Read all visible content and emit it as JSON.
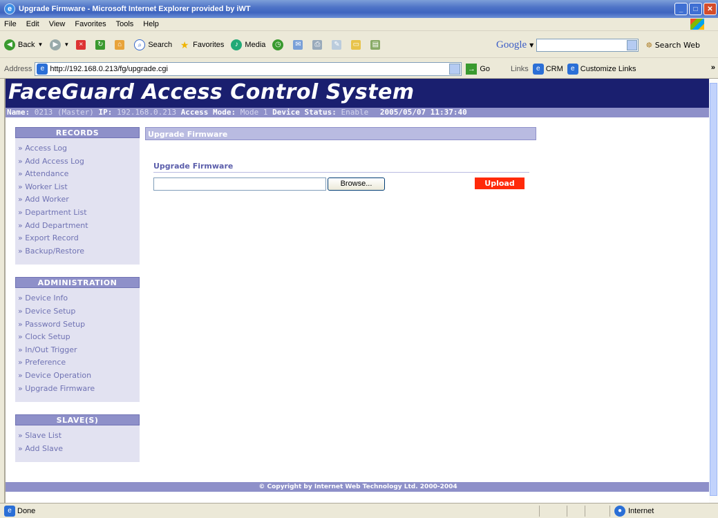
{
  "window": {
    "title": "Upgrade Firmware - Microsoft Internet Explorer provided by iWT"
  },
  "menu": [
    "File",
    "Edit",
    "View",
    "Favorites",
    "Tools",
    "Help"
  ],
  "toolbar": {
    "back": "Back",
    "search": "Search",
    "favorites": "Favorites",
    "media": "Media"
  },
  "google": {
    "logo": "Google",
    "search_web": "Search Web"
  },
  "address": {
    "label": "Address",
    "url": "http://192.168.0.213/fg/upgrade.cgi",
    "go": "Go",
    "links_label": "Links",
    "link1": "CRM",
    "link2": "Customize Links"
  },
  "page": {
    "banner": "FaceGuard Access Control System",
    "status": {
      "name_label": "Name:",
      "name_value": "0213 (Master)",
      "ip_label": "IP:",
      "ip_value": "192.168.0.213",
      "mode_label": "Access Mode:",
      "mode_value": "Mode 1",
      "device_label": "Device Status:",
      "device_value": "Enable",
      "datetime": "2005/05/07 11:37:40"
    },
    "sections": [
      {
        "title": "RECORDS",
        "items": [
          "» Access Log",
          "» Add Access Log",
          "» Attendance",
          "» Worker List",
          "» Add Worker",
          "» Department List",
          "» Add Department",
          "» Export Record",
          "» Backup/Restore"
        ]
      },
      {
        "title": "ADMINISTRATION",
        "items": [
          "» Device Info",
          "» Device Setup",
          "» Password Setup",
          "» Clock Setup",
          "» In/Out Trigger",
          "» Preference",
          "» Device Operation",
          "» Upgrade Firmware"
        ]
      },
      {
        "title": "SLAVE(S)",
        "items": [
          "» Slave List",
          "» Add Slave"
        ]
      }
    ],
    "page_title": "Upgrade Firmware",
    "form_title": "Upgrade Firmware",
    "browse_label": "Browse...",
    "upload_label": "Upload",
    "footer": "© Copyright by Internet Web Technology Ltd. 2000-2004"
  },
  "statusbar": {
    "text": "Done",
    "zone": "Internet"
  }
}
